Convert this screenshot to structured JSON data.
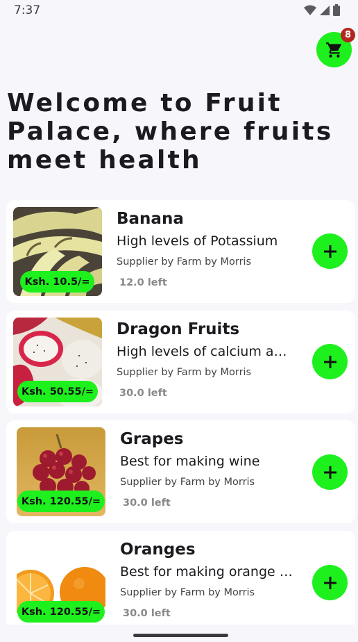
{
  "status_bar": {
    "time": "7:37"
  },
  "cart": {
    "count": "8"
  },
  "page_title": "Welcome to Fruit Palace, where fruits meet health",
  "products": [
    {
      "name": "Banana",
      "description": "High levels of Potassium",
      "supplier": "Supplier by Farm by Morris",
      "stock": "12.0 left",
      "price": "Ksh. 10.5/="
    },
    {
      "name": "Dragon Fruits",
      "description": "High levels of calcium and fibre",
      "supplier": "Supplier by Farm by Morris",
      "stock": "30.0 left",
      "price": "Ksh. 50.55/="
    },
    {
      "name": "Grapes",
      "description": "Best for making wine",
      "supplier": "Supplier by Farm by Morris",
      "stock": "30.0 left",
      "price": "Ksh. 120.55/="
    },
    {
      "name": "Oranges",
      "description": "Best for making orange marmalade",
      "supplier": "Supplier by Farm by Morris",
      "stock": "30.0 left",
      "price": "Ksh. 120.55/="
    }
  ],
  "colors": {
    "accent": "#1ef01e",
    "badge": "#b3261e",
    "background": "#f7f6fb"
  },
  "icons": {
    "cart": "shopping-cart-icon",
    "add": "plus-icon"
  }
}
